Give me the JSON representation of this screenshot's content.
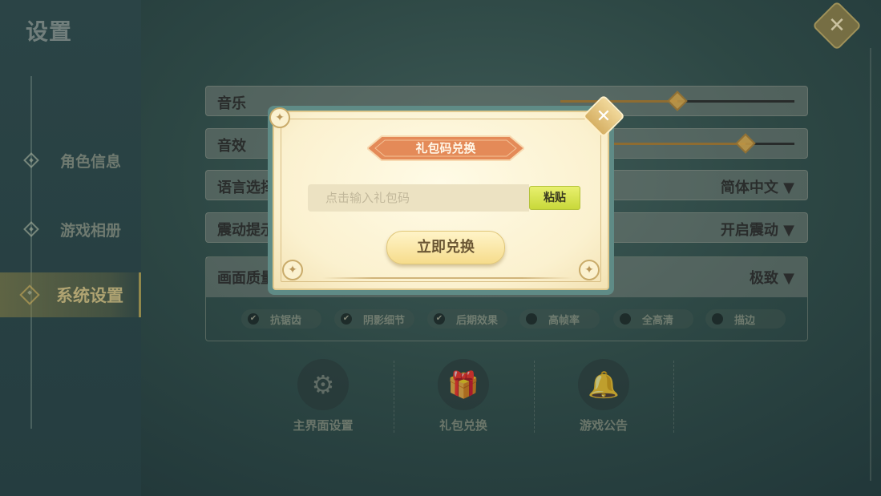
{
  "page": {
    "title": "设置"
  },
  "sidebar": {
    "items": [
      {
        "label": "角色信息",
        "active": false
      },
      {
        "label": "游戏相册",
        "active": false
      },
      {
        "label": "系统设置",
        "active": true
      }
    ]
  },
  "settings": {
    "music": {
      "label": "音乐",
      "level": 0.5
    },
    "sfx": {
      "label": "音效",
      "level": 0.79
    },
    "language": {
      "label": "语言选择",
      "value": "简体中文 ▼"
    },
    "vibration": {
      "label": "震动提示",
      "value": "开启震动 ▼"
    },
    "quality": {
      "label": "画面质量",
      "value": "极致 ▼",
      "options": [
        {
          "label": "抗锯齿",
          "checked": true
        },
        {
          "label": "阴影细节",
          "checked": true
        },
        {
          "label": "后期效果",
          "checked": true
        },
        {
          "label": "高帧率",
          "checked": false
        },
        {
          "label": "全高清",
          "checked": false
        },
        {
          "label": "描边",
          "checked": false
        }
      ]
    }
  },
  "bottom": {
    "main_ui": "主界面设置",
    "gift": "礼包兑换",
    "notice": "游戏公告"
  },
  "modal": {
    "title": "礼包码兑换",
    "input_placeholder": "点击输入礼包码",
    "paste_label": "粘贴",
    "redeem_label": "立即兑换"
  },
  "colors": {
    "banner": "#e48a58",
    "paste": "#d8e250",
    "modal_frame": "#5f8b86"
  }
}
